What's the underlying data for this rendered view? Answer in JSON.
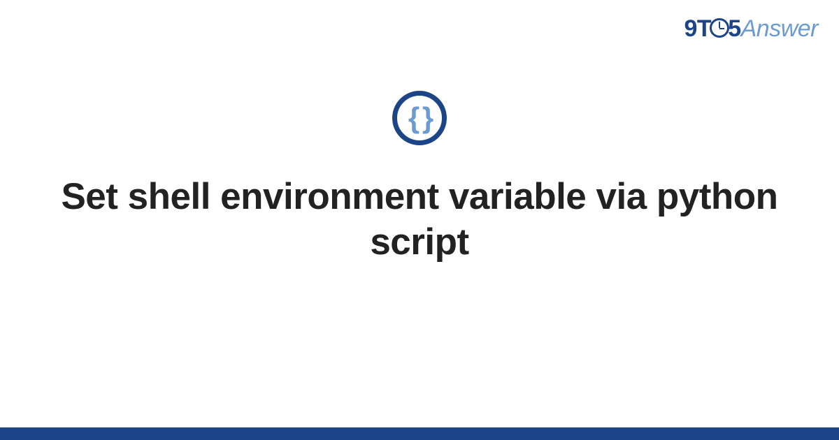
{
  "brand": {
    "part_9": "9",
    "part_t": "T",
    "part_5": "5",
    "part_answer": "Answer"
  },
  "icon": {
    "braces": "{ }"
  },
  "title": "Set shell environment variable via python script"
}
